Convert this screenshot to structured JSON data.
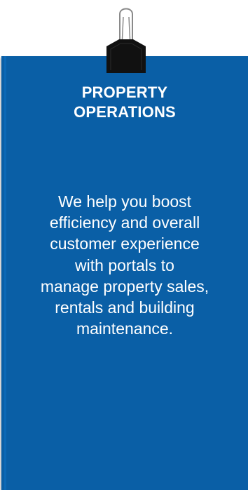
{
  "card": {
    "title_lines": [
      "PROPERTY",
      "OPERATIONS"
    ],
    "body_lines": [
      "We help you boost",
      "efficiency and overall",
      "customer experience",
      "with portals to",
      "manage property sales,",
      "rentals and building",
      "maintenance."
    ],
    "icon": "binder-clip-icon",
    "colors": {
      "card_background": "#0a5fa6",
      "text": "#ffffff",
      "clip": "#111111"
    }
  }
}
